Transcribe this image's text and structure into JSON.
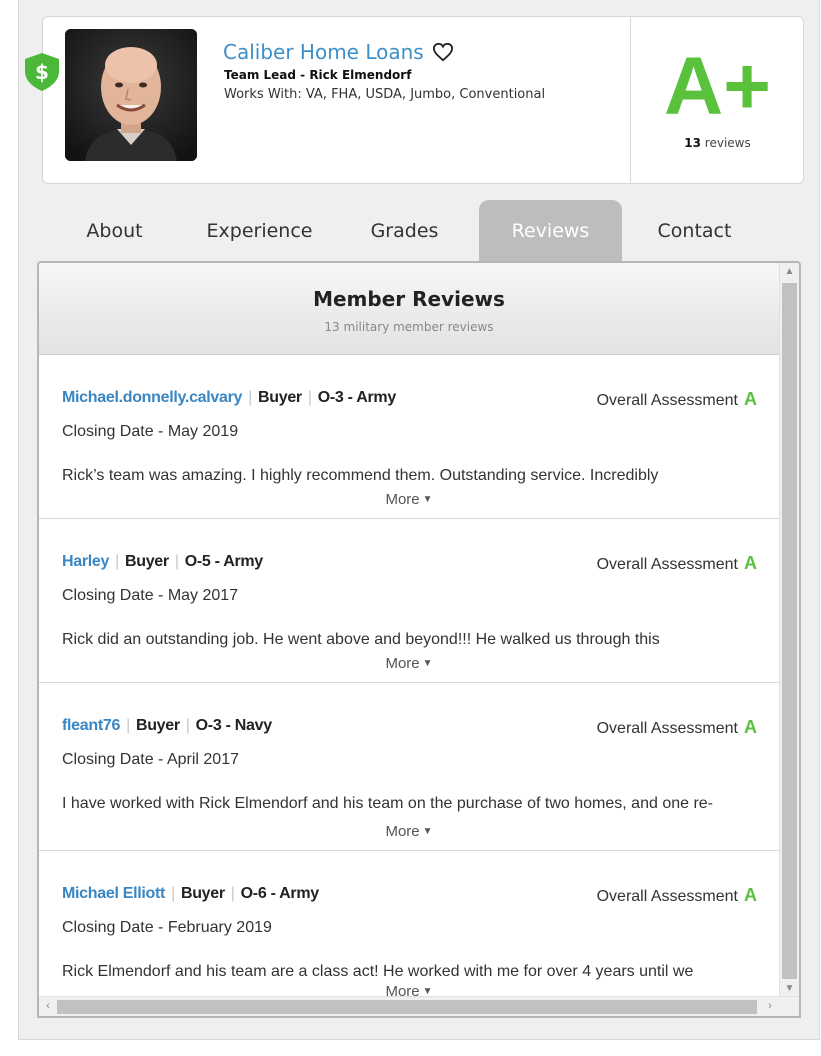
{
  "profile": {
    "company": "Caliber Home Loans",
    "team_lead": "Team Lead - Rick Elmendorf",
    "works_with": "Works With: VA, FHA, USDA, Jumbo, Conventional",
    "grade": "A+",
    "review_count": "13",
    "review_word": "reviews",
    "accent_green": "#5ac13c",
    "link_blue": "#3d8fc9"
  },
  "tabs": [
    {
      "label": "About",
      "active": false
    },
    {
      "label": "Experience",
      "active": false
    },
    {
      "label": "Grades",
      "active": false
    },
    {
      "label": "Reviews",
      "active": true
    },
    {
      "label": "Contact",
      "active": false
    }
  ],
  "reviews_panel": {
    "title": "Member Reviews",
    "subtitle": "13 military member reviews",
    "more_label": "More",
    "assessment_label": "Overall Assessment",
    "items": [
      {
        "name": "Michael.donnelly.calvary",
        "role": "Buyer",
        "rank": "O-3 - Army",
        "grade": "A",
        "closing": "Closing Date - May 2019",
        "text": "Rick’s team was amazing. I highly recommend them. Outstanding service. Incredibly"
      },
      {
        "name": "Harley",
        "role": "Buyer",
        "rank": "O-5 - Army",
        "grade": "A",
        "closing": "Closing Date - May 2017",
        "text": "Rick did an outstanding job. He went above and beyond!!! He walked us through this"
      },
      {
        "name": "fleant76",
        "role": "Buyer",
        "rank": "O-3 - Navy",
        "grade": "A",
        "closing": "Closing Date - April 2017",
        "text": "I have worked with Rick Elmendorf and his team on the purchase of two homes, and one re-"
      },
      {
        "name": "Michael Elliott",
        "role": "Buyer",
        "rank": "O-6 - Army",
        "grade": "A",
        "closing": "Closing Date - February 2019",
        "text": "Rick Elmendorf and his team are a class act! He worked with me for over 4 years until we"
      }
    ]
  }
}
